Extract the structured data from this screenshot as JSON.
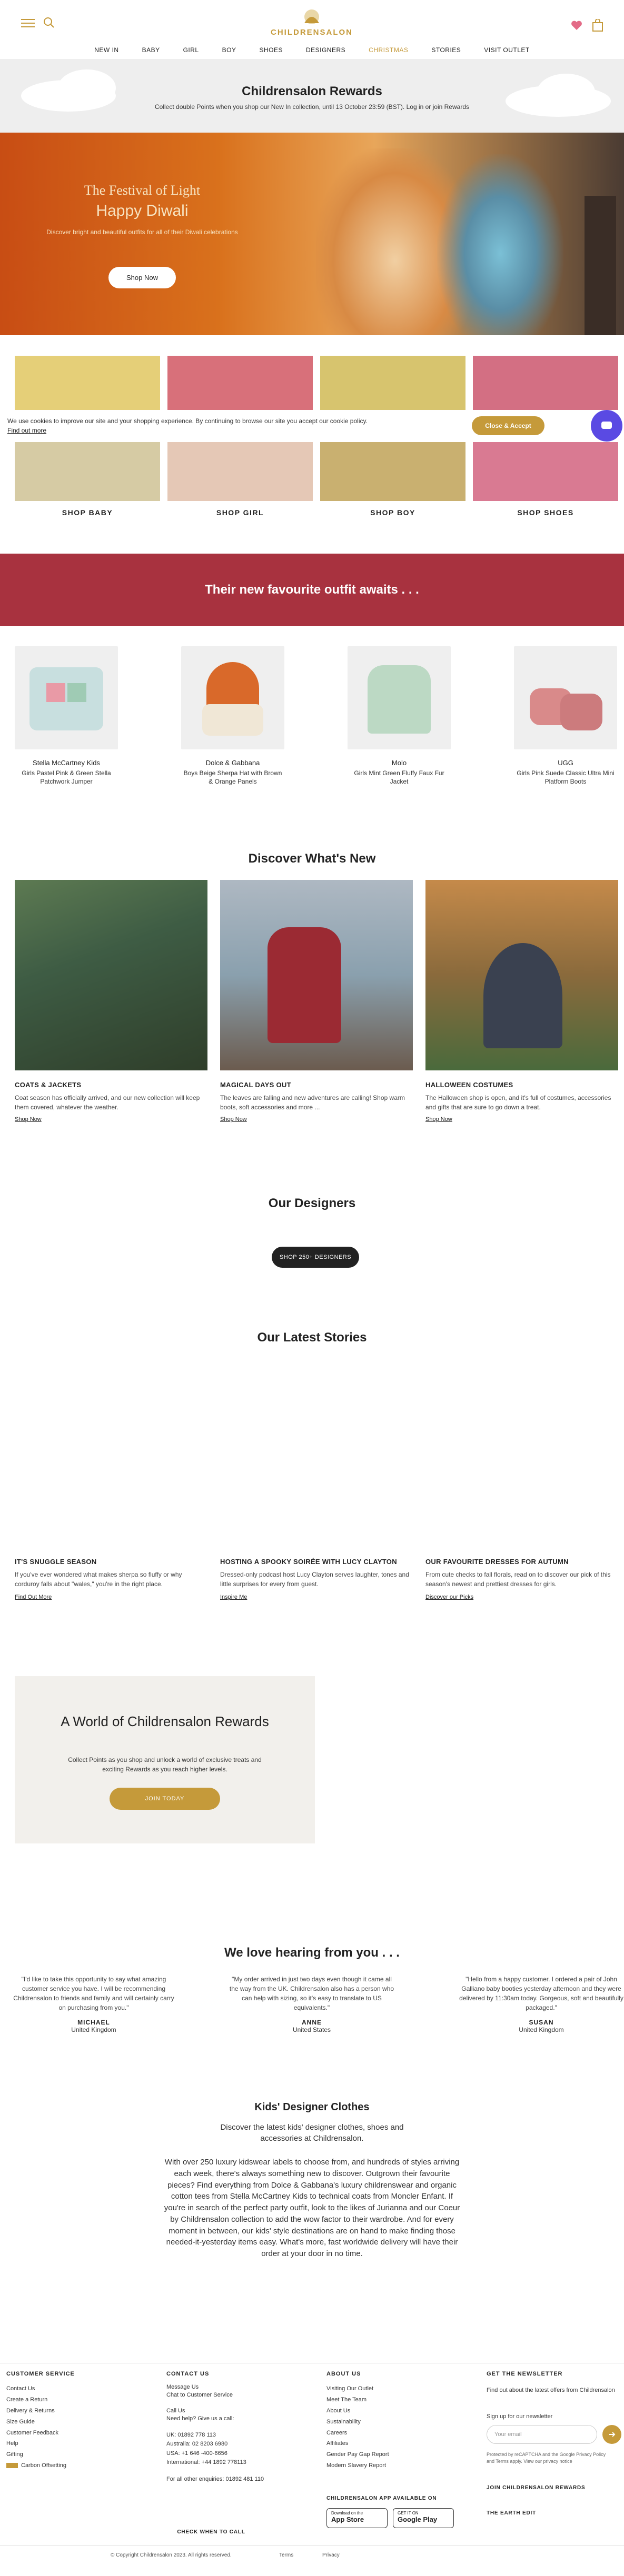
{
  "header": {
    "logo": "CHILDRENSALON",
    "nav": [
      "NEW IN",
      "BABY",
      "GIRL",
      "BOY",
      "SHOES",
      "DESIGNERS",
      "CHRISTMAS",
      "STORIES",
      "VISIT OUTLET"
    ]
  },
  "rewards_band": {
    "title": "Childrensalon Rewards",
    "text": "Collect double Points when you shop our New In collection, until 13 October 23:59 (BST). Log in or join Rewards"
  },
  "hero": {
    "title1": "The Festival of Light",
    "title2": "Happy Diwali",
    "subtitle": "Discover bright and beautiful outfits for all of their Diwali celebrations",
    "button": "Shop Now"
  },
  "cookie": {
    "text": "We use cookies to improve our site and your shopping experience. By continuing to browse our site you accept our cookie policy.",
    "link": "Find out more",
    "button": "Close & Accept"
  },
  "categories": [
    "SHOP BABY",
    "SHOP GIRL",
    "SHOP BOY",
    "SHOP SHOES"
  ],
  "outfit_banner": "Their new favourite outfit awaits . . .",
  "products": [
    {
      "brand": "Stella McCartney Kids",
      "title": "Girls Pastel Pink & Green Stella Patchwork Jumper"
    },
    {
      "brand": "Dolce & Gabbana",
      "title": "Boys Beige Sherpa Hat with Brown & Orange Panels"
    },
    {
      "brand": "Molo",
      "title": "Girls Mint Green Fluffy Faux Fur Jacket"
    },
    {
      "brand": "UGG",
      "title": "Girls Pink Suede Classic Ultra Mini Platform Boots"
    }
  ],
  "discover": {
    "title": "Discover What's New",
    "items": [
      {
        "heading": "COATS & JACKETS",
        "text": "Coat season has officially arrived, and our new collection will keep them covered, whatever the weather.",
        "link": "Shop Now"
      },
      {
        "heading": "MAGICAL DAYS OUT",
        "text": "The leaves are falling and new adventures are calling! Shop warm boots, soft accessories and more ...",
        "link": "Shop Now"
      },
      {
        "heading": "HALLOWEEN COSTUMES",
        "text": "The Halloween shop is open, and it's full of costumes, accessories and gifts that are sure to go down a treat.",
        "link": "Shop Now"
      }
    ]
  },
  "designers": {
    "title": "Our Designers",
    "button": "SHOP 250+ DESIGNERS"
  },
  "stories": {
    "title": "Our Latest Stories",
    "items": [
      {
        "heading": "IT'S SNUGGLE SEASON",
        "text": "If you've ever wondered what makes sherpa so fluffy or why corduroy falls about \"wales,\" you're in the right place.",
        "link": "Find Out More"
      },
      {
        "heading": "HOSTING A SPOOKY SOIRÉE WITH LUCY CLAYTON",
        "text": "Dressed-only podcast host Lucy Clayton serves laughter, tones and little surprises for every from guest.",
        "link": "Inspire Me"
      },
      {
        "heading": "OUR FAVOURITE DRESSES FOR AUTUMN",
        "text": "From cute checks to fall florals, read on to discover our pick of this season's newest and prettiest dresses for girls.",
        "link": "Discover our Picks"
      }
    ]
  },
  "rewards_card": {
    "title": "A World of Childrensalon Rewards",
    "text": "Collect Points as you shop and unlock a world of exclusive treats and exciting Rewards as you reach higher levels.",
    "button": "JOIN TODAY"
  },
  "testimonials": {
    "title": "We love hearing from you . . .",
    "items": [
      {
        "quote": "\"I'd like to take this opportunity to say what amazing customer service you have. I will be recommending Childrensalon to friends and family and will certainly carry on purchasing from you.\"",
        "name": "MICHAEL",
        "country": "United Kingdom"
      },
      {
        "quote": "\"My order arrived in just two days even though it came all the way from the UK. Childrensalon also has a person who can help with sizing, so it's easy to translate to US equivalents.\"",
        "name": "ANNE",
        "country": "United States"
      },
      {
        "quote": "\"Hello from a happy customer. I ordered a pair of John Galliano baby booties yesterday afternoon and they were delivered by 11:30am today. Gorgeous, soft and beautifully packaged.\"",
        "name": "SUSAN",
        "country": "United Kingdom"
      }
    ]
  },
  "seo": {
    "title": "Kids' Designer Clothes",
    "intro": "Discover the latest kids' designer clothes, shoes and accessories at Childrensalon.",
    "body": "With over 250 luxury kidswear labels to choose from, and hundreds of styles arriving each week, there's always something new to discover. Outgrown their favourite pieces? Find everything from Dolce & Gabbana's luxury childrenswear and organic cotton tees from Stella McCartney Kids to technical coats from Moncler Enfant. If you're in search of the perfect party outfit, look to the likes of Jurianna and our Coeur by Childrensalon collection to add the wow factor to their wardrobe. And for every moment in between, our kids' style destinations are on hand to make finding those needed-it-yesterday items easy. What's more, fast worldwide delivery will have their order at your door in no time."
  },
  "footer": {
    "customer_service": {
      "title": "CUSTOMER SERVICE",
      "items": [
        "Contact Us",
        "Create a Return",
        "Delivery & Returns",
        "Size Guide",
        "Customer Feedback",
        "Help",
        "Gifting",
        "Carbon Offsetting"
      ]
    },
    "contact": {
      "title": "CONTACT US",
      "items": [
        "Message Us",
        "Chat to Customer Service",
        "",
        "Call Us",
        "Need help? Give us a call:",
        "",
        "UK: 01892 778 113",
        "Australia: 02 8203 6980",
        "USA: +1 646 -400-6656",
        "International: +44 1892 778113",
        "",
        "For all other enquiries: 01892 481 110"
      ],
      "button": "CHECK WHEN TO CALL"
    },
    "about": {
      "title": "ABOUT US",
      "items": [
        "Visiting Our Outlet",
        "Meet The Team",
        "About Us",
        "Sustainability",
        "Careers",
        "Affiliates",
        "Gender Pay Gap Report",
        "Modern Slavery Report"
      ]
    },
    "newsletter": {
      "title": "GET THE NEWSLETTER",
      "text": "Find out about the latest offers from Childrensalon",
      "label": "Sign up for our newsletter",
      "placeholder": "Your email",
      "recaptcha": "Protected by reCAPTCHA and the Google Privacy Policy and Terms apply. View our privacy notice",
      "join": "JOIN CHILDRENSALON REWARDS",
      "next": "THE EARTH EDIT"
    },
    "app": {
      "title": "CHILDRENSALON APP AVAILABLE ON",
      "appstore": "App Store",
      "play": "Google Play",
      "appstore_small": "Download on the",
      "play_small": "GET IT ON"
    },
    "copyright": "© Copyright Childrensalon 2023. All rights reserved.",
    "terms": "Terms",
    "privacy": "Privacy"
  },
  "colors": {
    "gold": "#c59a3a",
    "red_banner": "#a8323f",
    "cookie_bg": "#ffffff"
  }
}
